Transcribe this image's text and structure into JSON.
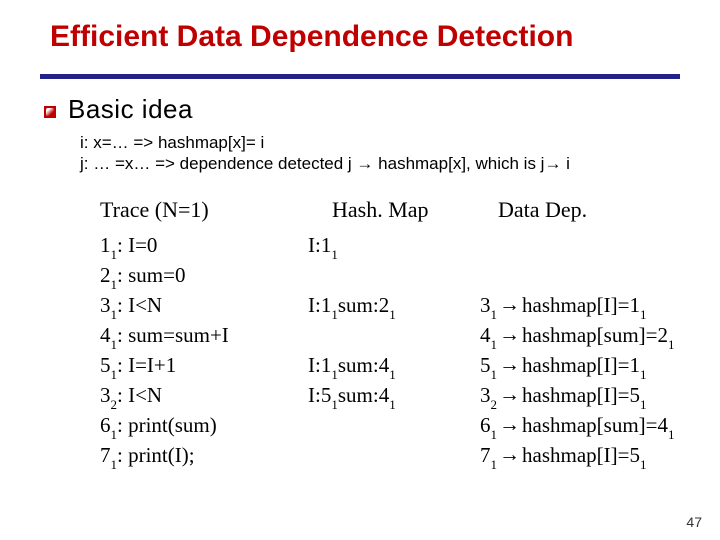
{
  "title": "Efficient Data Dependence Detection",
  "basic_idea_label": "Basic idea",
  "idea": {
    "line1": "i: x=…   =>   hashmap[x]= i",
    "line2": "j: … =x…   =>   dependence detected j → hashmap[x], which is j→ i"
  },
  "trace": {
    "title": "Trace (N=1)",
    "rows": [
      {
        "label_main": "1",
        "label_sub": "1",
        "text": ": I=0"
      },
      {
        "label_main": "2",
        "label_sub": "1",
        "text": ": sum=0"
      },
      {
        "label_main": "3",
        "label_sub": "1",
        "text": ": I<N"
      },
      {
        "label_main": "4",
        "label_sub": "1",
        "text": ": sum=sum+I"
      },
      {
        "label_main": "5",
        "label_sub": "1",
        "text": ": I=I+1"
      },
      {
        "label_main": "3",
        "label_sub": "2",
        "text": ": I<N"
      },
      {
        "label_main": "6",
        "label_sub": "1",
        "text": ": print(sum)"
      },
      {
        "label_main": "7",
        "label_sub": "1",
        "text": ": print(I);"
      }
    ]
  },
  "hashmap": {
    "title": "Hash. Map",
    "rows": [
      "I: 1_1",
      "",
      "I: 1_1 sum: 2_1",
      "",
      "I: 1_1 sum: 4_1",
      "I: 5_1 sum: 4_1"
    ]
  },
  "datadep": {
    "title": "Data Dep.",
    "rows": [
      {
        "lhs_main": "3",
        "lhs_sub": "1",
        "rhs": "hashmap[I]=1",
        "rhs_sub": "1"
      },
      {
        "lhs_main": "4",
        "lhs_sub": "1",
        "rhs": "hashmap[sum]=2",
        "rhs_sub": "1"
      },
      {
        "lhs_main": "5",
        "lhs_sub": "1",
        "rhs": "hashmap[I]=1",
        "rhs_sub": "1"
      },
      {
        "lhs_main": "3",
        "lhs_sub": "2",
        "rhs": "hashmap[I]=5",
        "rhs_sub": "1"
      },
      {
        "lhs_main": "6",
        "lhs_sub": "1",
        "rhs": "hashmap[sum]=4",
        "rhs_sub": "1"
      },
      {
        "lhs_main": "7",
        "lhs_sub": "1",
        "rhs": "hashmap[I]=5",
        "rhs_sub": "1"
      }
    ]
  },
  "page_number": "47"
}
